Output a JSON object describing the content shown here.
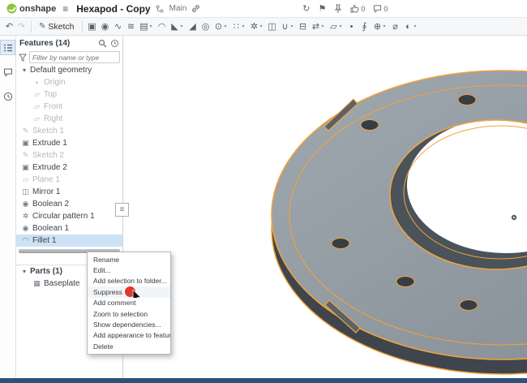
{
  "topbar": {
    "logo_text": "onshape",
    "title": "Hexapod - Copy",
    "workspace": "Main",
    "counts": {
      "likes": "0",
      "comments": "0"
    }
  },
  "toolbar": {
    "sketch_label": "Sketch",
    "icons": [
      {
        "name": "extrude",
        "glyph": "▣",
        "caret": false
      },
      {
        "name": "revolve",
        "glyph": "◉",
        "caret": false
      },
      {
        "name": "sweep",
        "glyph": "∿",
        "caret": false
      },
      {
        "name": "loft",
        "glyph": "≋",
        "caret": false
      },
      {
        "name": "thicken",
        "glyph": "▤",
        "caret": true
      },
      {
        "name": "fillet",
        "glyph": "◠",
        "caret": false
      },
      {
        "name": "chamfer",
        "glyph": "◣",
        "caret": true
      },
      {
        "name": "draft",
        "glyph": "◢",
        "caret": false
      },
      {
        "name": "shell",
        "glyph": "◎",
        "caret": false
      },
      {
        "name": "hole",
        "glyph": "⊙",
        "caret": true
      },
      {
        "name": "linear-pattern",
        "glyph": "∷",
        "caret": true
      },
      {
        "name": "circular-pattern",
        "glyph": "✲",
        "caret": true
      },
      {
        "name": "mirror",
        "glyph": "◫",
        "caret": false
      },
      {
        "name": "boolean",
        "glyph": "∪",
        "caret": true
      },
      {
        "name": "split",
        "glyph": "⊟",
        "caret": false
      },
      {
        "name": "transform",
        "glyph": "⇄",
        "caret": true
      },
      {
        "name": "plane",
        "glyph": "▱",
        "caret": true
      },
      {
        "name": "point",
        "glyph": "•",
        "caret": false
      },
      {
        "name": "helix",
        "glyph": "∮",
        "caret": false
      },
      {
        "name": "mate-connector",
        "glyph": "⊕",
        "caret": true
      },
      {
        "name": "measure",
        "glyph": "⌀",
        "caret": false
      },
      {
        "name": "appearance",
        "glyph": "◐",
        "caret": true
      }
    ]
  },
  "icon_glyphs": {
    "caret": "▾",
    "chevron_down": "▾",
    "undo": "↶",
    "redo": "↷",
    "pencil": "✎",
    "refresh": "↻",
    "flag": "⚑",
    "origin": "•",
    "plane": "▱",
    "sketch": "✎",
    "extrude": "▣",
    "mirror": "◫",
    "boolean": "◉",
    "circular_pattern": "✲",
    "fillet": "◠",
    "part": "▦",
    "menu_lines": "≡"
  },
  "features_panel": {
    "title": "Features (14)",
    "filter_placeholder": "Filter by name or type",
    "tree": [
      {
        "label": "Default geometry"
      },
      {
        "label": "Origin"
      },
      {
        "label": "Top"
      },
      {
        "label": "Front"
      },
      {
        "label": "Right"
      },
      {
        "label": "Sketch 1"
      },
      {
        "label": "Extrude 1"
      },
      {
        "label": "Sketch 2"
      },
      {
        "label": "Extrude 2"
      },
      {
        "label": "Plane 1"
      },
      {
        "label": "Mirror 1"
      },
      {
        "label": "Boolean 2"
      },
      {
        "label": "Circular pattern 1"
      },
      {
        "label": "Boolean 1"
      },
      {
        "label": "Fillet 1"
      }
    ],
    "parts_title": "Parts (1)",
    "parts": [
      {
        "label": "Baseplate"
      }
    ]
  },
  "context_menu": {
    "items": [
      "Rename",
      "Edit...",
      "Add selection to folder...",
      "Suppress",
      "Add comment",
      "Zoom to selection",
      "Show dependencies...",
      "Add appearance to feature...",
      "Delete"
    ]
  },
  "colors": {
    "selection_orange": "#f1a33c",
    "part_top_gray": "#929aa2",
    "part_side_gray": "#3e454c",
    "selected_row_blue": "#cde2f5",
    "annotation_red": "#e6352b",
    "onshape_green": "#8dc63f"
  }
}
